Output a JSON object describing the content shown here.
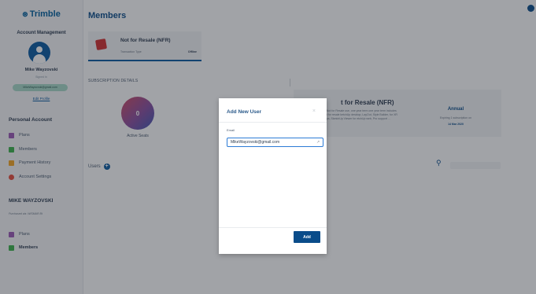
{
  "sidebar": {
    "logo": {
      "text": "Trimble",
      "glyph": "⊛"
    },
    "account_title": "Account Management",
    "user_name": "Mike Wayzovski",
    "signed_in": "Signed In",
    "email": "MikeWayzovski@gmail.com",
    "edit_profile": "Edit Profile",
    "personal_account": {
      "heading": "Personal Account",
      "items": [
        {
          "label": "Plans",
          "icon": "plans-icon"
        },
        {
          "label": "Members",
          "icon": "members-icon"
        },
        {
          "label": "Payment History",
          "icon": "payment-icon"
        },
        {
          "label": "Account Settings",
          "icon": "settings-icon"
        }
      ]
    },
    "org_account": {
      "heading": "MIKE WAYZOVSKI",
      "subtitle": "Purchased via: WISMAR Bt",
      "items": [
        {
          "label": "Plans",
          "icon": "plans-icon"
        },
        {
          "label": "Members",
          "icon": "members-icon"
        }
      ]
    }
  },
  "main": {
    "title": "Members",
    "product": {
      "name": "Not for Resale (NFR)",
      "tx_label": "Transaction Type",
      "tx_value": "Offline"
    },
    "subscription_details": "SUBSCRIPTION DETAILS",
    "active_seats": {
      "count": "0",
      "label": "Active Seats"
    },
    "users_label": "Users",
    "subscription_card": {
      "name": "t for Resale (NFR)",
      "description": "e, Not for Resale use, one year term one year term includes not for resale ketchUp desktop, LayOut, Style Builder, for XR apps, SketchUp Viewer for etchUp web, Pro support ...",
      "term": "Annual",
      "expiring": "Expiring 1 subscription on",
      "date": "14 Mar 2020"
    }
  },
  "modal": {
    "title": "Add New User",
    "close": "×",
    "email_label": "Email",
    "email_value": "MikeWayzovski@gmail.com",
    "add_button": "Add"
  },
  "colors": {
    "brand": "#0a4c8a",
    "accent": "#0a5aa1",
    "pill": "#a7d9c9",
    "sketchup_red": "#d32f2f"
  }
}
